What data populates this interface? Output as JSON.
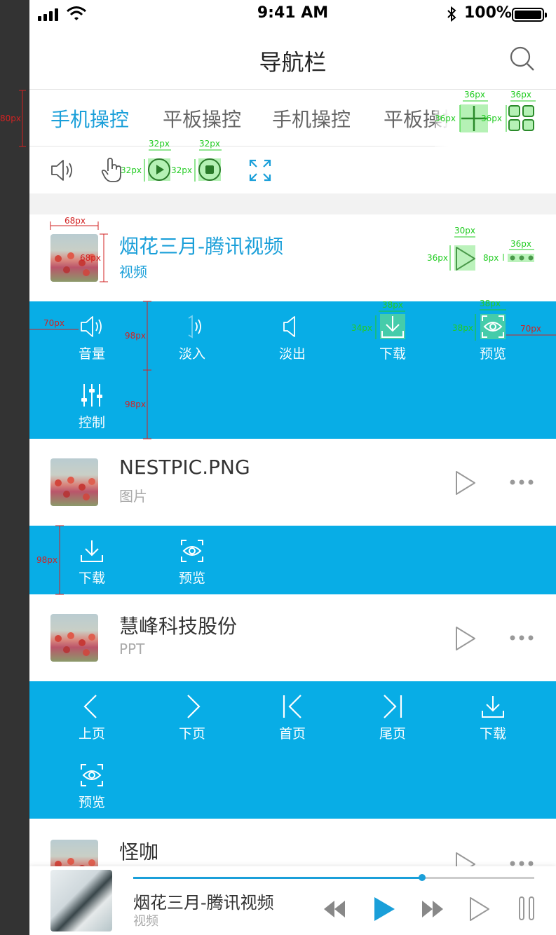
{
  "status_bar": {
    "time": "9:41 AM",
    "battery": "100%"
  },
  "nav": {
    "title": "导航栏"
  },
  "tabs": [
    {
      "label": "手机操控",
      "active": true
    },
    {
      "label": "平板操控",
      "active": false
    },
    {
      "label": "手机操控",
      "active": false
    },
    {
      "label": "平板操控",
      "active": false
    }
  ],
  "toolbar_icons": [
    "volume-icon",
    "touch-hand-icon",
    "play-circle-icon",
    "stop-circle-icon",
    "fullscreen-icon"
  ],
  "items": [
    {
      "title": "烟花三月-腾讯视频",
      "subtitle": "视频",
      "active": true
    },
    {
      "title": "NESTPIC.PNG",
      "subtitle": "图片",
      "active": false
    },
    {
      "title": "慧峰科技股份",
      "subtitle": "PPT",
      "active": false
    },
    {
      "title": "怪咖",
      "subtitle": "",
      "active": false
    }
  ],
  "panels": {
    "video": [
      {
        "label": "音量",
        "icon": "volume-icon"
      },
      {
        "label": "淡入",
        "icon": "fade-in-icon"
      },
      {
        "label": "淡出",
        "icon": "fade-out-icon"
      },
      {
        "label": "下载",
        "icon": "download-icon"
      },
      {
        "label": "预览",
        "icon": "preview-icon"
      },
      {
        "label": "控制",
        "icon": "sliders-icon"
      }
    ],
    "image": [
      {
        "label": "下载",
        "icon": "download-icon"
      },
      {
        "label": "预览",
        "icon": "preview-icon"
      }
    ],
    "ppt": [
      {
        "label": "上页",
        "icon": "chevron-left-icon"
      },
      {
        "label": "下页",
        "icon": "chevron-right-icon"
      },
      {
        "label": "首页",
        "icon": "first-page-icon"
      },
      {
        "label": "尾页",
        "icon": "last-page-icon"
      },
      {
        "label": "下载",
        "icon": "download-icon"
      },
      {
        "label": "预览",
        "icon": "preview-icon"
      }
    ]
  },
  "player": {
    "title": "烟花三月-腾讯视频",
    "subtitle": "视频",
    "progress": 0.72
  },
  "annotations": {
    "a36": "36px",
    "a32": "32px",
    "a80": "80px",
    "a68": "68px",
    "a30": "30px",
    "a8": "8px",
    "a70": "70px",
    "a98": "98px",
    "a38": "38px",
    "a34": "34px"
  },
  "colors": {
    "accent": "#08ade6",
    "active_text": "#1a9fd9",
    "text": "#333333",
    "muted": "#aaaaaa",
    "spec_green": "#22cc22",
    "spec_red": "#d22222"
  }
}
